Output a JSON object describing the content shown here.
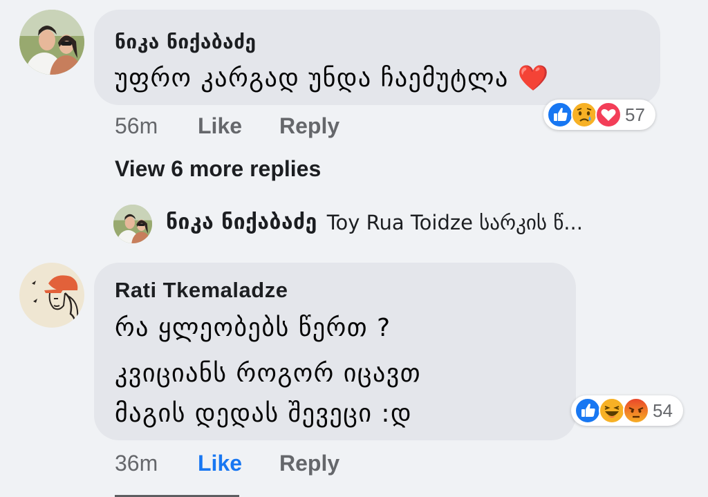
{
  "comments": [
    {
      "author": "ნიკა ნიქაბაძე",
      "lines": [
        "უფრო კარგად უნდა ჩაემუტლა"
      ],
      "emoji": "❤️",
      "time": "56m",
      "like_label": "Like",
      "reply_label": "Reply",
      "reactions": {
        "icons": [
          "like-icon",
          "sad-icon",
          "love-icon"
        ],
        "count": "57"
      },
      "liked_by_viewer": false
    },
    {
      "author": "Rati Tkemaladze",
      "lines": [
        "რა ყლეობებს წერთ ?",
        "კვიციანს როგორ იცავთ",
        "მაგის დედას შევეცი :დ"
      ],
      "time": "36m",
      "like_label": "Like",
      "reply_label": "Reply",
      "reactions": {
        "icons": [
          "like-icon",
          "haha-icon",
          "angry-icon"
        ],
        "count": "54"
      },
      "liked_by_viewer": true
    }
  ],
  "replies": {
    "view_more_label": "View 6 more replies",
    "preview": {
      "author": "ნიკა ნიქაბაძე",
      "text": "Toy Rua Toidze სარკის წ..."
    }
  },
  "colors": {
    "background": "#f0f2f5",
    "bubble": "#e4e6eb",
    "muted_text": "#65676b",
    "like_active": "#1877f2",
    "love": "#f33e58",
    "emoji_yellow": "#f7b125"
  }
}
